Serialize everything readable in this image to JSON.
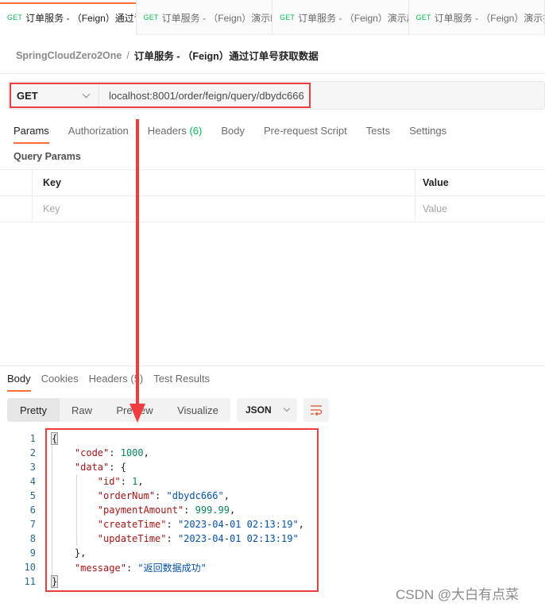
{
  "tabs": [
    {
      "method": "GET",
      "name": "订单服务 - （Feign）通过订单号获取数据",
      "active": true
    },
    {
      "method": "GET",
      "name": "订单服务 - （Feign）演示Feign",
      "active": false
    },
    {
      "method": "GET",
      "name": "订单服务 - （Feign）演示超时",
      "active": false
    },
    {
      "method": "GET",
      "name": "订单服务 - （Feign）演示报错",
      "active": false
    }
  ],
  "breadcrumb": {
    "collection": "SpringCloudZero2One",
    "separator": "/",
    "request": "订单服务 - （Feign）通过订单号获取数据"
  },
  "request": {
    "method": "GET",
    "url": "localhost:8001/order/feign/query/dbydc666"
  },
  "request_tabs": [
    {
      "label": "Params",
      "active": true
    },
    {
      "label": "Authorization"
    },
    {
      "label": "Headers",
      "count": "(6)"
    },
    {
      "label": "Body"
    },
    {
      "label": "Pre-request Script"
    },
    {
      "label": "Tests"
    },
    {
      "label": "Settings"
    }
  ],
  "query_params": {
    "title": "Query Params",
    "columns": [
      "Key",
      "Value"
    ],
    "placeholder_key": "Key",
    "placeholder_value": "Value"
  },
  "response_tabs": [
    {
      "label": "Body",
      "active": true
    },
    {
      "label": "Cookies"
    },
    {
      "label": "Headers (5)"
    },
    {
      "label": "Test Results"
    }
  ],
  "view_modes": [
    "Pretty",
    "Raw",
    "Preview",
    "Visualize"
  ],
  "format": "JSON",
  "response_body": {
    "line_numbers": [
      "1",
      "2",
      "3",
      "4",
      "5",
      "6",
      "7",
      "8",
      "9",
      "10",
      "11"
    ],
    "code": "1000",
    "id": "1",
    "orderNum": "\"dbydc666\"",
    "paymentAmount": "999.99",
    "createTime": "\"2023-04-01 02:13:19\"",
    "updateTime": "\"2023-04-01 02:13:19\"",
    "message": "\"返回数据成功\""
  },
  "watermark": "CSDN @大白有点菜",
  "colors": {
    "accent": "#ff6c37",
    "method_get": "#0cbb52",
    "annotation_red": "#f03b3f"
  }
}
